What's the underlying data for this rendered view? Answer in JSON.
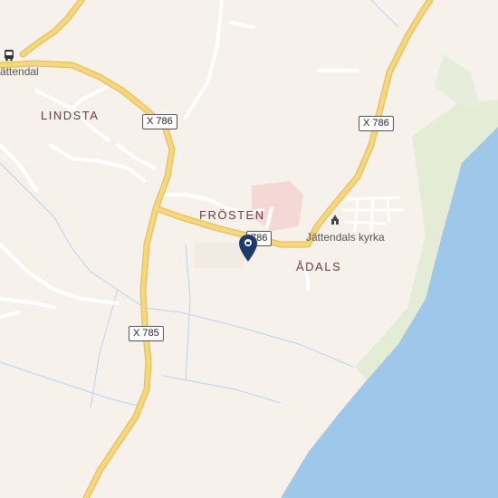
{
  "map": {
    "places": {
      "lindsta": "LINDSTA",
      "frosten": "FRÖSTEN",
      "adals": "ÅDALS"
    },
    "stations": {
      "jattendal": "Jättendal"
    },
    "pois": {
      "church": "Jättendals kyrka"
    },
    "road_shields": {
      "x786_a": "X 786",
      "x786_b": "X 786",
      "x786_c": "786",
      "x785": "X 785"
    },
    "icons": {
      "bus_stop": "bus-icon",
      "church": "church-icon",
      "marker": "location-pin-icon"
    },
    "colors": {
      "land": "#f6f1ea",
      "water": "#9fc7ea",
      "main_road": "#f2cf70",
      "minor_road": "#ffffff",
      "park": "#e4ecd6",
      "urban": "#f4d8d6",
      "marker": "#1c3a6b"
    }
  }
}
